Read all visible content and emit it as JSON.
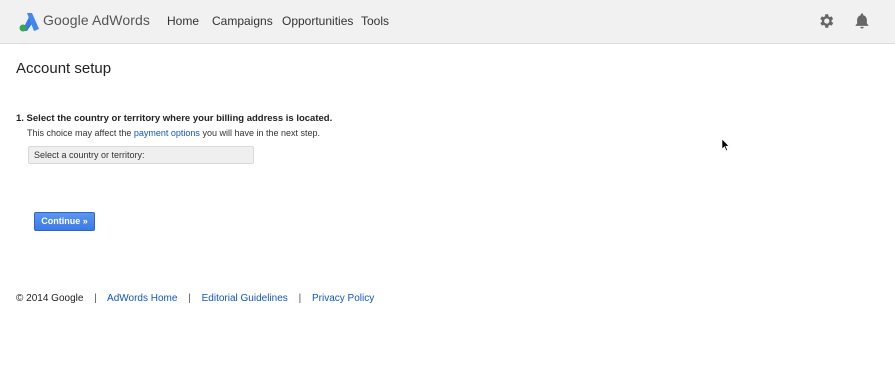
{
  "header": {
    "app_name": "Google AdWords",
    "nav": {
      "home": "Home",
      "campaigns": "Campaigns",
      "opportunities": "Opportunities",
      "tools": "Tools"
    },
    "icons": {
      "logo": "adwords-logo-icon",
      "settings": "gear-icon",
      "notifications": "bell-icon"
    }
  },
  "page": {
    "title": "Account setup",
    "step": {
      "heading": "1. Select the country or territory where your billing address is located.",
      "desc_before": "This choice may affect the ",
      "desc_link": "payment options",
      "desc_after": " you will have in the next step."
    },
    "country_select": {
      "value": "Select a country or territory:"
    },
    "continue_label": "Continue »"
  },
  "footer": {
    "copyright": "© 2014 Google",
    "separator": "|",
    "links": {
      "adwords_home": "AdWords Home",
      "editorial": "Editorial Guidelines",
      "privacy": "Privacy Policy"
    }
  },
  "colors": {
    "link": "#1155cc",
    "button": "#4d8af0",
    "topbar": "#f1f1f1"
  }
}
